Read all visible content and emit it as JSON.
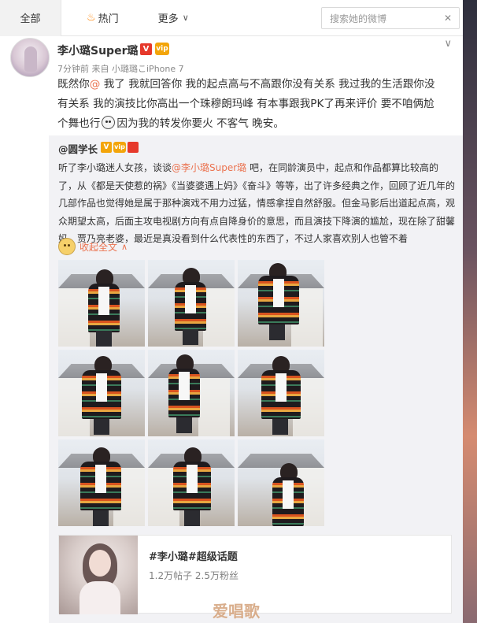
{
  "nav": {
    "tab_all": "全部",
    "tab_hot": "热门",
    "tab_more": "更多",
    "search_placeholder": "搜索她的微博"
  },
  "post": {
    "author": "李小璐Super璐",
    "verified_badge": "V",
    "member_badge": "vip",
    "time": "7分钟前",
    "source_prefix": "来自",
    "source": "小璐璐こiPhone 7",
    "text_line1_a": "既然你",
    "text_line1_at": "@",
    "text_line1_b": " 我了 我就回答你 我的起点高与不高跟你没有关系 我过我的生活跟你没",
    "text_line2": "有关系 我的演技比你高出一个珠穆朗玛峰 有本事跟我PK了再来评价 要不咱俩尬",
    "text_line3_a": "个舞也行",
    "text_line3_b": "因为我的转发你要火 不客气 晚安。"
  },
  "repost": {
    "author": "@圆学长",
    "text_a": "听了李小璐迷人女孩，谈谈",
    "text_at": "@李小璐Super璐",
    "text_b": " 吧，在同龄演员中，起点和作品都算比较高的了，从《都是天使惹的祸》《当婆婆遇上妈》《奋斗》等等，出了许多经典之作，回顾了近几年的几部作品也觉得她是属于那种演戏不用力过猛，情感拿捏自然舒服。但金马影后出道起点高，观众期望太高，后面主攻电视剧方向有点自降身价的意思，而且演技下降演的尴尬，现在除了甜馨妈，贾乃亮老婆，最近是真没看到什么代表性的东西了，不过人家喜欢别人也管不着",
    "collapse_label": "收起全文",
    "topic": {
      "title": "#李小璐#超级话题",
      "stats": "1.2万帖子 2.5万粉丝"
    }
  },
  "watermark": "爱唱歌",
  "colors": {
    "accent_link": "#eb7350",
    "brand_orange": "#ff8200",
    "verified_red": "#e6392b",
    "member_gold": "#f3a50a"
  }
}
